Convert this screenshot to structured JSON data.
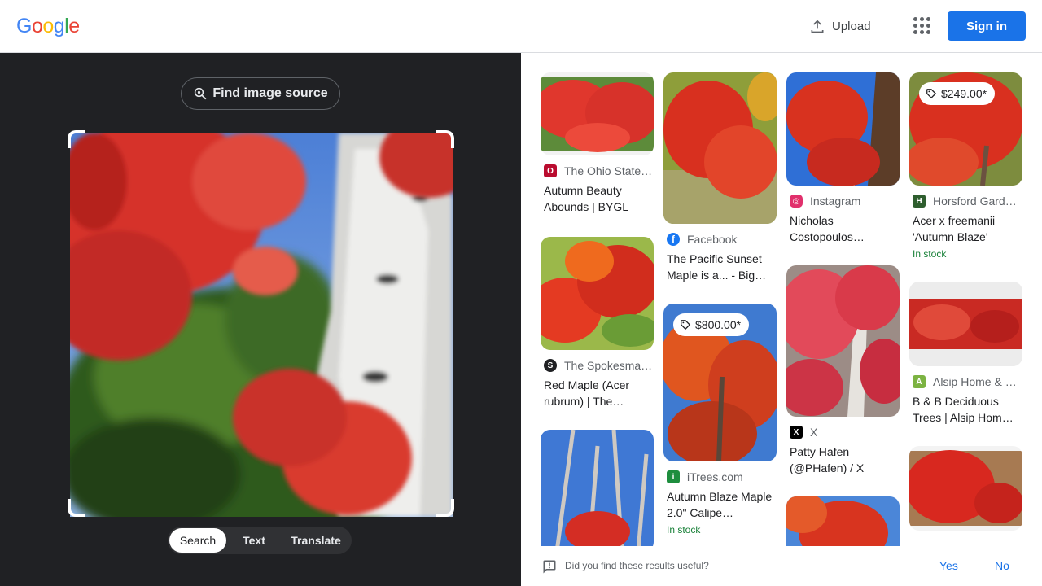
{
  "header": {
    "logo_letters": [
      {
        "char": "G",
        "color": "#4285F4"
      },
      {
        "char": "o",
        "color": "#EA4335"
      },
      {
        "char": "o",
        "color": "#FBBC05"
      },
      {
        "char": "g",
        "color": "#4285F4"
      },
      {
        "char": "l",
        "color": "#34A853"
      },
      {
        "char": "e",
        "color": "#EA4335"
      }
    ],
    "upload_label": "Upload",
    "apps_icon": "apps-grid-icon",
    "signin_label": "Sign in"
  },
  "lens": {
    "find_source_label": "Find image source",
    "tabs": [
      {
        "label": "Search",
        "active": true
      },
      {
        "label": "Text",
        "active": false
      },
      {
        "label": "Translate",
        "active": false
      }
    ]
  },
  "results": {
    "col1": [
      {
        "source": "The Ohio State…",
        "favicon_color": "#ba0c2f",
        "favicon_letter": "O",
        "title": "Autumn Beauty Abounds | BYGL"
      },
      {
        "source": "The Spokesma…",
        "favicon_color": "#202124",
        "favicon_letter": "S",
        "title": "Red Maple (Acer rubrum) | The…"
      },
      {
        "source": "",
        "favicon_color": "#ffffff",
        "favicon_letter": "",
        "title": ""
      }
    ],
    "col2": [
      {
        "source": "Facebook",
        "favicon_color": "#1877f2",
        "favicon_letter": "f",
        "title": "The Pacific Sunset Maple is a... - Big…"
      },
      {
        "source": "iTrees.com",
        "favicon_color": "#1e8e3e",
        "favicon_letter": "i",
        "title": "Autumn Blaze Maple 2.0\" Calipe…",
        "price": "$800.00*",
        "stock": "In stock"
      }
    ],
    "col3": [
      {
        "source": "Instagram",
        "favicon_color": "#e1306c",
        "favicon_letter": "◎",
        "title": "Nicholas Costopoulos…"
      },
      {
        "source": "X",
        "favicon_color": "#000000",
        "favicon_letter": "X",
        "title": "Patty Hafen (@PHafen) / X"
      },
      {
        "source": "",
        "favicon_color": "#ffffff",
        "favicon_letter": "",
        "title": ""
      }
    ],
    "col4": [
      {
        "source": "Horsford Gard…",
        "favicon_color": "#2e5e2e",
        "favicon_letter": "H",
        "title": "Acer x freemanii 'Autumn Blaze'",
        "price": "$249.00*",
        "stock": "In stock"
      },
      {
        "source": "Alsip Home & …",
        "favicon_color": "#7cb342",
        "favicon_letter": "A",
        "title": "B & B Deciduous Trees | Alsip Hom…"
      },
      {
        "source": "",
        "favicon_color": "#ffffff",
        "favicon_letter": "",
        "title": ""
      }
    ]
  },
  "feedback": {
    "question": "Did you find these results useful?",
    "yes_label": "Yes",
    "no_label": "No"
  }
}
